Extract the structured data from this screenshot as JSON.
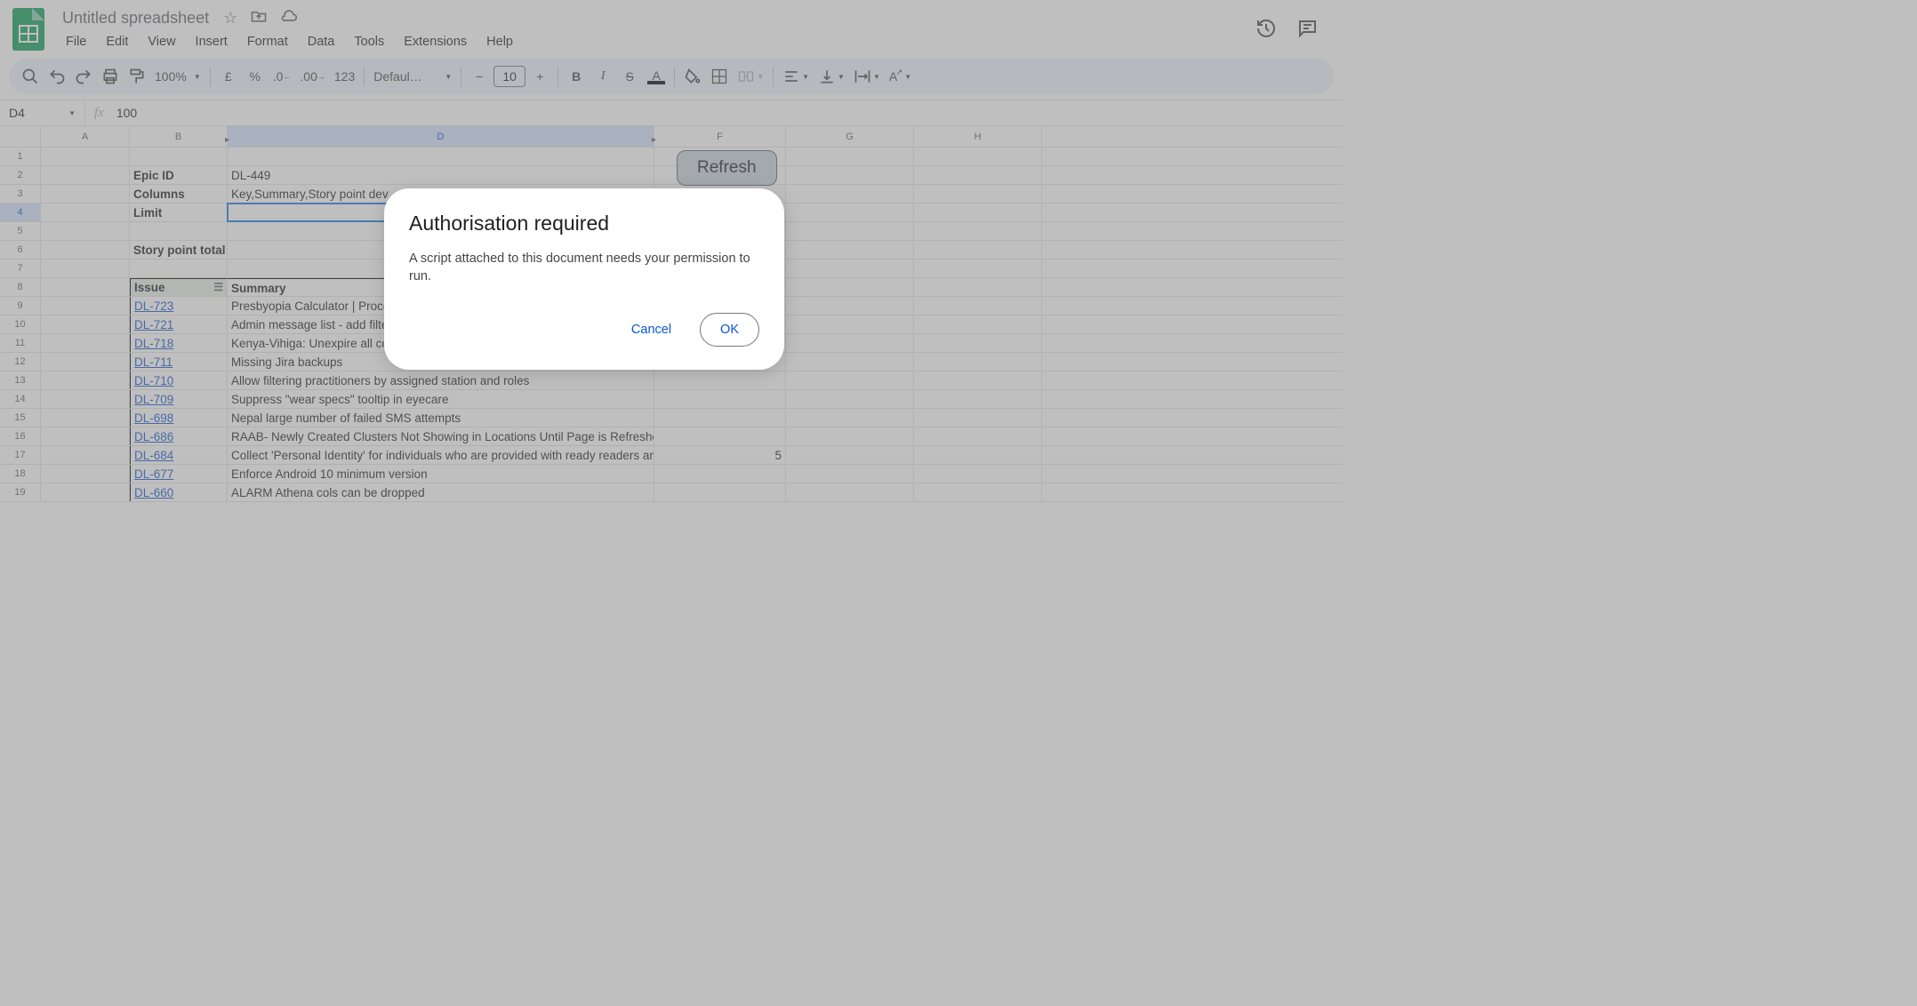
{
  "doc": {
    "title": "Untitled spreadsheet"
  },
  "menus": [
    "File",
    "Edit",
    "View",
    "Insert",
    "Format",
    "Data",
    "Tools",
    "Extensions",
    "Help"
  ],
  "toolbar": {
    "zoom": "100%",
    "currency": "£",
    "percent": "%",
    "dec_dec": ".0",
    "inc_dec": ".00",
    "num_fmt": "123",
    "font": "Defaul…",
    "font_size": "10"
  },
  "name_box": "D4",
  "formula": "100",
  "columns": {
    "A": 100,
    "B": 110,
    "D": 480,
    "F": 148,
    "G": 144,
    "H": 144
  },
  "refresh_label": "Refresh",
  "cells": {
    "B2": "Epic ID",
    "D2": "DL-449",
    "B3": "Columns",
    "D3": "Key,Summary,Story point dev",
    "B4": "Limit",
    "B6": "Story point total",
    "B8": "Issue",
    "D8": "Summary",
    "B9": "DL-723",
    "D9": "Presbyopia Calculator | Proceed button not working on three devices",
    "B10": "DL-721",
    "D10": "Admin message list - add filter for 'everywhere'",
    "B11": "DL-718",
    "D11": "Kenya-Vihiga: Unexpire all contents",
    "B12": "DL-711",
    "D12": "Missing Jira backups",
    "B13": "DL-710",
    "D13": "Allow filtering practitioners by assigned station and roles",
    "B14": "DL-709",
    "D14": "Suppress \"wear specs\" tooltip in eyecare",
    "B15": "DL-698",
    "D15": "Nepal large number of failed SMS attempts",
    "B16": "DL-686",
    "D16": "RAAB- Newly Created Clusters Not Showing in Locations Until Page is Refreshed",
    "B17": "DL-684",
    "D17": "Collect 'Personal Identity' for individuals who are provided with ready readers and referrals",
    "F17": "5",
    "B18": "DL-677",
    "D18": "Enforce Android 10 minimum version",
    "B19": "DL-660",
    "D19": "ALARM Athena cols can be dropped"
  },
  "dialog": {
    "title": "Authorisation required",
    "message": "A script attached to this document needs your permission to run.",
    "cancel": "Cancel",
    "ok": "OK"
  }
}
